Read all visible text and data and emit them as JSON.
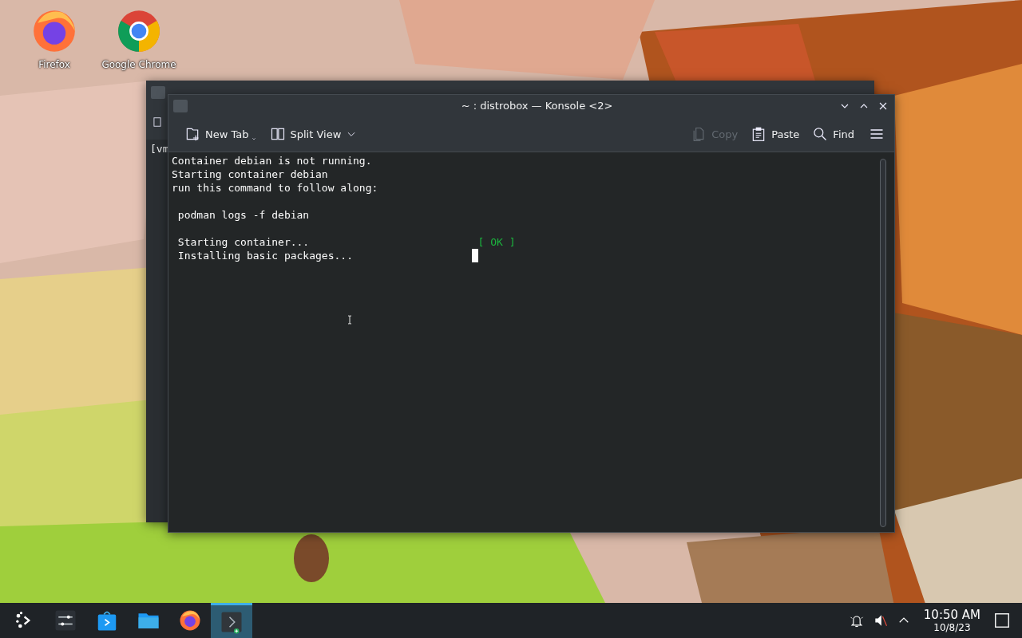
{
  "desktop_icons": [
    {
      "kind": "firefox",
      "label": "Firefox"
    },
    {
      "kind": "chrome",
      "label": "Google Chrome"
    }
  ],
  "back_window": {
    "terminal_text": "[vm"
  },
  "window": {
    "title": "~ : distrobox — Konsole <2>",
    "toolbar": [
      {
        "kind": "new-tab",
        "label": "New Tab",
        "disabled": false
      },
      {
        "kind": "split-view",
        "label": "Split View",
        "disabled": false
      },
      {
        "kind": "copy",
        "label": "Copy",
        "disabled": true
      },
      {
        "kind": "paste",
        "label": "Paste",
        "disabled": false
      },
      {
        "kind": "find",
        "label": "Find",
        "disabled": false
      }
    ],
    "terminal": {
      "lines": [
        {
          "kind": "text",
          "text": "Container debian is not running."
        },
        {
          "kind": "text",
          "text": "Starting container debian"
        },
        {
          "kind": "text",
          "text": "run this command to follow along:"
        },
        {
          "kind": "blank"
        },
        {
          "kind": "text",
          "text": " podman logs -f debian"
        },
        {
          "kind": "blank"
        },
        {
          "kind": "text",
          "text": " Starting container...",
          "status": {
            "text": "[ OK ]",
            "ok": true
          }
        },
        {
          "kind": "text",
          "text": " Installing basic packages...",
          "cursor": true
        }
      ]
    }
  },
  "taskbar": {
    "tasks": [
      {
        "kind": "launcher",
        "selected": false
      },
      {
        "kind": "settings",
        "selected": false
      },
      {
        "kind": "store",
        "selected": false
      },
      {
        "kind": "files",
        "selected": false
      },
      {
        "kind": "firefox",
        "selected": false
      },
      {
        "kind": "konsole",
        "selected": true
      }
    ],
    "tray": {
      "muted": true,
      "time": "10:50 AM",
      "date": "10/8/23"
    }
  }
}
